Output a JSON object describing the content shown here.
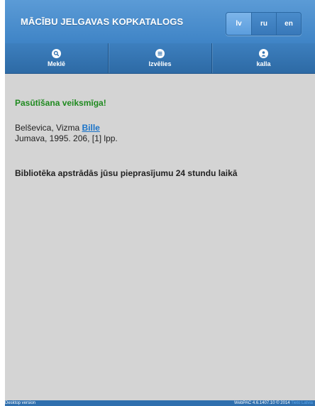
{
  "header": {
    "title": "MĀCĪBU JELGAVAS KOPKATALOGS",
    "languages": [
      {
        "label": "lv",
        "active": true
      },
      {
        "label": "ru",
        "active": false
      },
      {
        "label": "en",
        "active": false
      }
    ]
  },
  "nav": {
    "items": [
      {
        "label": "Meklē",
        "icon": "search-icon"
      },
      {
        "label": "Izvēlies",
        "icon": "list-icon"
      },
      {
        "label": "kalla",
        "icon": "user-icon"
      }
    ]
  },
  "main": {
    "success_message": "Pasūtīšana veiksmīga!",
    "record": {
      "author": "Belševica, Vizma",
      "title": "Bille",
      "publication": "Jumava, 1995. 206, [1] lpp."
    },
    "notice": "Bibliotēka apstrādās jūsu pieprasījumu 24 stundu laikā"
  },
  "footer": {
    "desktop_link": "Desktop version",
    "version_text": "WebPAC 4.6.1407.10 © 2014",
    "vendor_link": "Tieto Latvia"
  },
  "colors": {
    "header": "#4a8ccb",
    "nav": "#2d6aa5",
    "success": "#1f8a1f",
    "link": "#1a73c8",
    "background": "#d4d4d4"
  }
}
